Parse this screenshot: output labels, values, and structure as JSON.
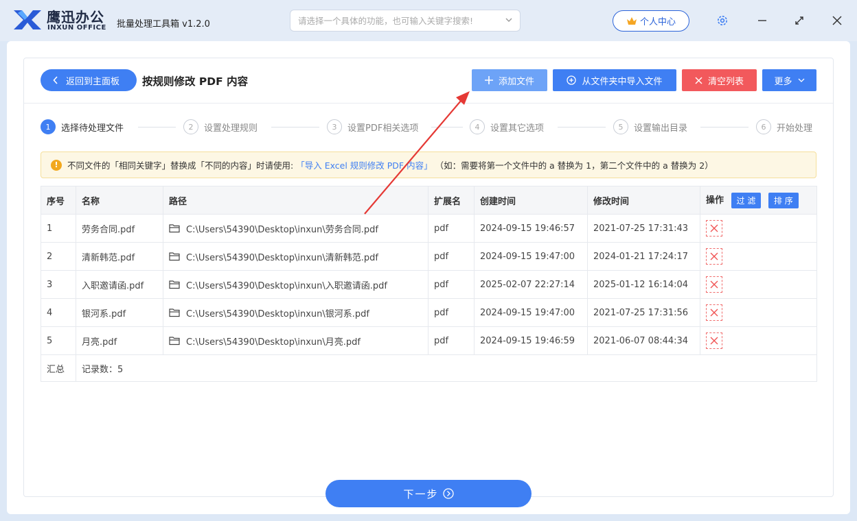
{
  "brand": {
    "cn": "鹰迅办公",
    "en": "INXUN OFFICE"
  },
  "app_title": "批量处理工具箱 v1.2.0",
  "search": {
    "placeholder": "请选择一个具体的功能，也可输入关键字搜索!"
  },
  "user_center": "个人中心",
  "colors": {
    "primary": "#3f7ff3",
    "danger": "#f2595c",
    "light_primary": "#6da3f7",
    "warning": "#f2a81d",
    "arrow": "#e53935"
  },
  "header": {
    "back_label": "返回到主面板",
    "page_title": "按规则修改 PDF 内容"
  },
  "toolbar": {
    "add_label": "添加文件",
    "import_label": "从文件夹中导入文件",
    "clear_label": "清空列表",
    "more_label": "更多"
  },
  "steps": [
    {
      "num": "1",
      "label": "选择待处理文件"
    },
    {
      "num": "2",
      "label": "设置处理规则"
    },
    {
      "num": "3",
      "label": "设置PDF相关选项"
    },
    {
      "num": "4",
      "label": "设置其它选项"
    },
    {
      "num": "5",
      "label": "设置输出目录"
    },
    {
      "num": "6",
      "label": "开始处理"
    }
  ],
  "notice": {
    "icon": "!",
    "text_before": "不同文件的「相同关键字」替换成「不同的内容」时请使用:",
    "link": "「导入 Excel 规则修改 PDF 内容」",
    "text_after": "（如：需要将第一个文件中的 a 替换为 1，第二个文件中的 a 替换为 2）"
  },
  "table": {
    "headers": {
      "index": "序号",
      "name": "名称",
      "path": "路径",
      "ext": "扩展名",
      "created": "创建时间",
      "modified": "修改时间",
      "action": "操作",
      "filter": "过 滤",
      "sort": "排 序"
    },
    "rows": [
      {
        "index": "1",
        "name": "劳务合同.pdf",
        "path": "C:\\Users\\54390\\Desktop\\inxun\\劳务合同.pdf",
        "ext": "pdf",
        "created": "2024-09-15 19:46:57",
        "modified": "2021-07-25 17:31:43"
      },
      {
        "index": "2",
        "name": "清新韩范.pdf",
        "path": "C:\\Users\\54390\\Desktop\\inxun\\清新韩范.pdf",
        "ext": "pdf",
        "created": "2024-09-15 19:47:00",
        "modified": "2024-01-21 17:24:17"
      },
      {
        "index": "3",
        "name": "入职邀请函.pdf",
        "path": "C:\\Users\\54390\\Desktop\\inxun\\入职邀请函.pdf",
        "ext": "pdf",
        "created": "2025-02-07 22:27:14",
        "modified": "2025-01-12 16:14:04"
      },
      {
        "index": "4",
        "name": "银河系.pdf",
        "path": "C:\\Users\\54390\\Desktop\\inxun\\银河系.pdf",
        "ext": "pdf",
        "created": "2024-09-15 19:47:00",
        "modified": "2021-07-25 17:31:56"
      },
      {
        "index": "5",
        "name": "月亮.pdf",
        "path": "C:\\Users\\54390\\Desktop\\inxun\\月亮.pdf",
        "ext": "pdf",
        "created": "2024-09-15 19:46:59",
        "modified": "2021-06-07 08:44:34"
      }
    ],
    "summary": {
      "label": "汇总",
      "count": "记录数：5"
    }
  },
  "next_label": "下一步"
}
